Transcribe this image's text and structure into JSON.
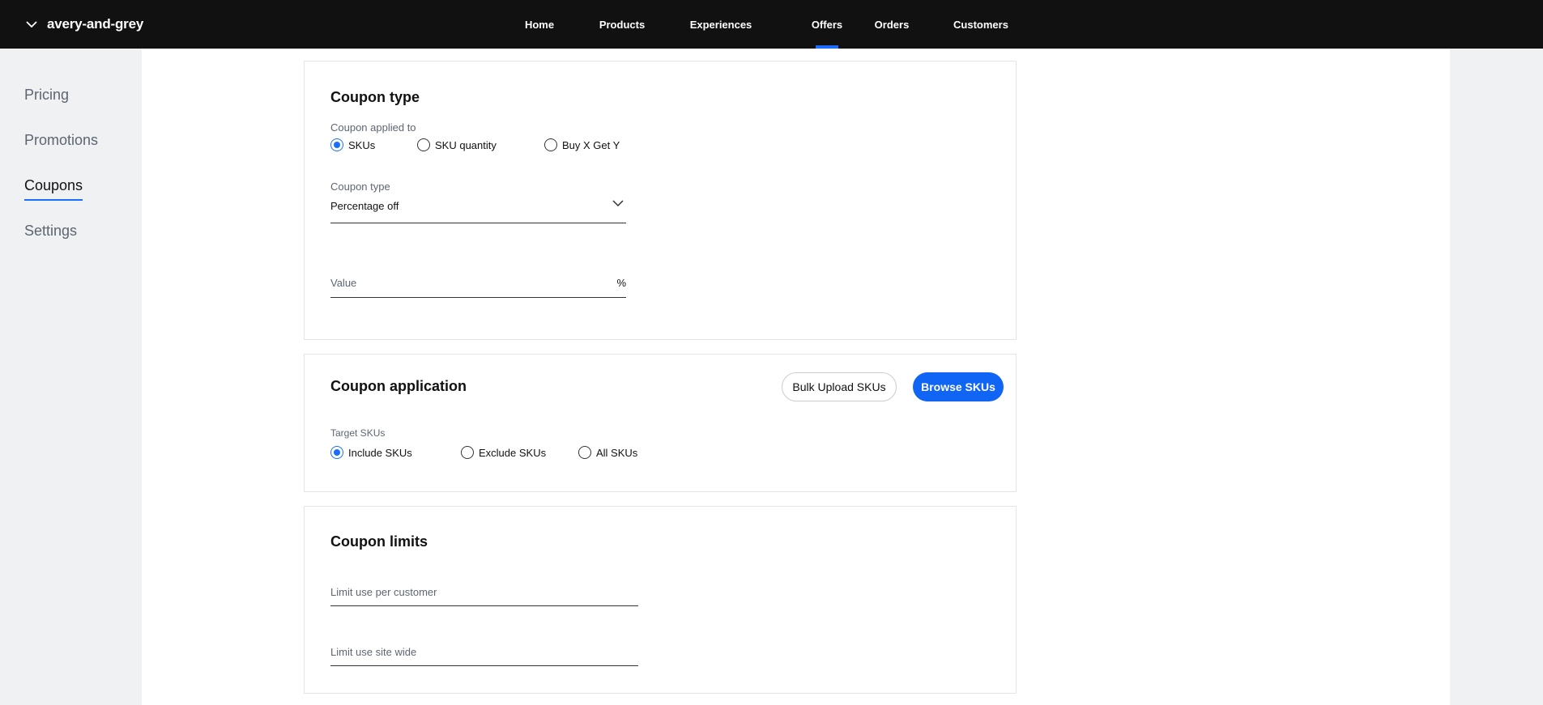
{
  "header": {
    "brand": "avery-and-grey",
    "nav": [
      {
        "label": "Home"
      },
      {
        "label": "Products"
      },
      {
        "label": "Experiences"
      },
      {
        "label": "Offers",
        "active": true
      },
      {
        "label": "Orders"
      },
      {
        "label": "Customers"
      }
    ]
  },
  "sidebar": {
    "items": [
      {
        "label": "Pricing"
      },
      {
        "label": "Promotions"
      },
      {
        "label": "Coupons",
        "active": true
      },
      {
        "label": "Settings"
      }
    ]
  },
  "coupon_type_card": {
    "title": "Coupon type",
    "applied_to_label": "Coupon applied to",
    "applied_to_options": [
      {
        "label": "SKUs",
        "checked": true
      },
      {
        "label": "SKU quantity",
        "checked": false
      },
      {
        "label": "Buy X Get Y",
        "checked": false
      }
    ],
    "type_label": "Coupon type",
    "type_value": "Percentage off",
    "value_placeholder": "Value",
    "value_suffix": "%"
  },
  "coupon_application_card": {
    "title": "Coupon application",
    "bulk_upload_label": "Bulk Upload SKUs",
    "browse_label": "Browse SKUs",
    "target_label": "Target SKUs",
    "target_options": [
      {
        "label": "Include SKUs",
        "checked": true
      },
      {
        "label": "Exclude SKUs",
        "checked": false
      },
      {
        "label": "All SKUs",
        "checked": false
      }
    ]
  },
  "coupon_limits_card": {
    "title": "Coupon limits",
    "per_customer_placeholder": "Limit use per customer",
    "site_wide_placeholder": "Limit use site wide"
  },
  "colors": {
    "accent": "#1a6dff",
    "header_bg": "#111111",
    "page_bg": "#eff1f3"
  }
}
